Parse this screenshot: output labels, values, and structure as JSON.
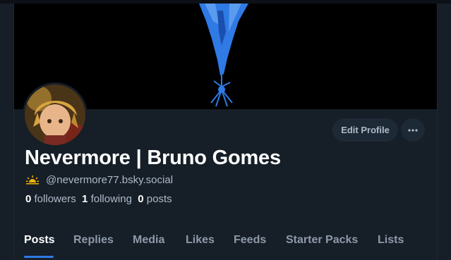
{
  "profile": {
    "display_name": "Nevermore | Bruno Gomes",
    "handle": "@nevermore77.bsky.social",
    "followers_count": "0",
    "followers_label": "followers",
    "following_count": "1",
    "following_label": "following",
    "posts_count": "0",
    "posts_label": "posts"
  },
  "actions": {
    "edit_profile_label": "Edit Profile",
    "more_icon": "ellipsis-icon"
  },
  "tabs": [
    {
      "label": "Posts",
      "active": true
    },
    {
      "label": "Replies"
    },
    {
      "label": "Media"
    },
    {
      "label": "Likes"
    },
    {
      "label": "Feeds"
    },
    {
      "label": "Starter Packs"
    },
    {
      "label": "Lists"
    }
  ],
  "colors": {
    "background": "#161e27",
    "accent": "#2f7ae5",
    "button_bg": "#1e2936"
  }
}
